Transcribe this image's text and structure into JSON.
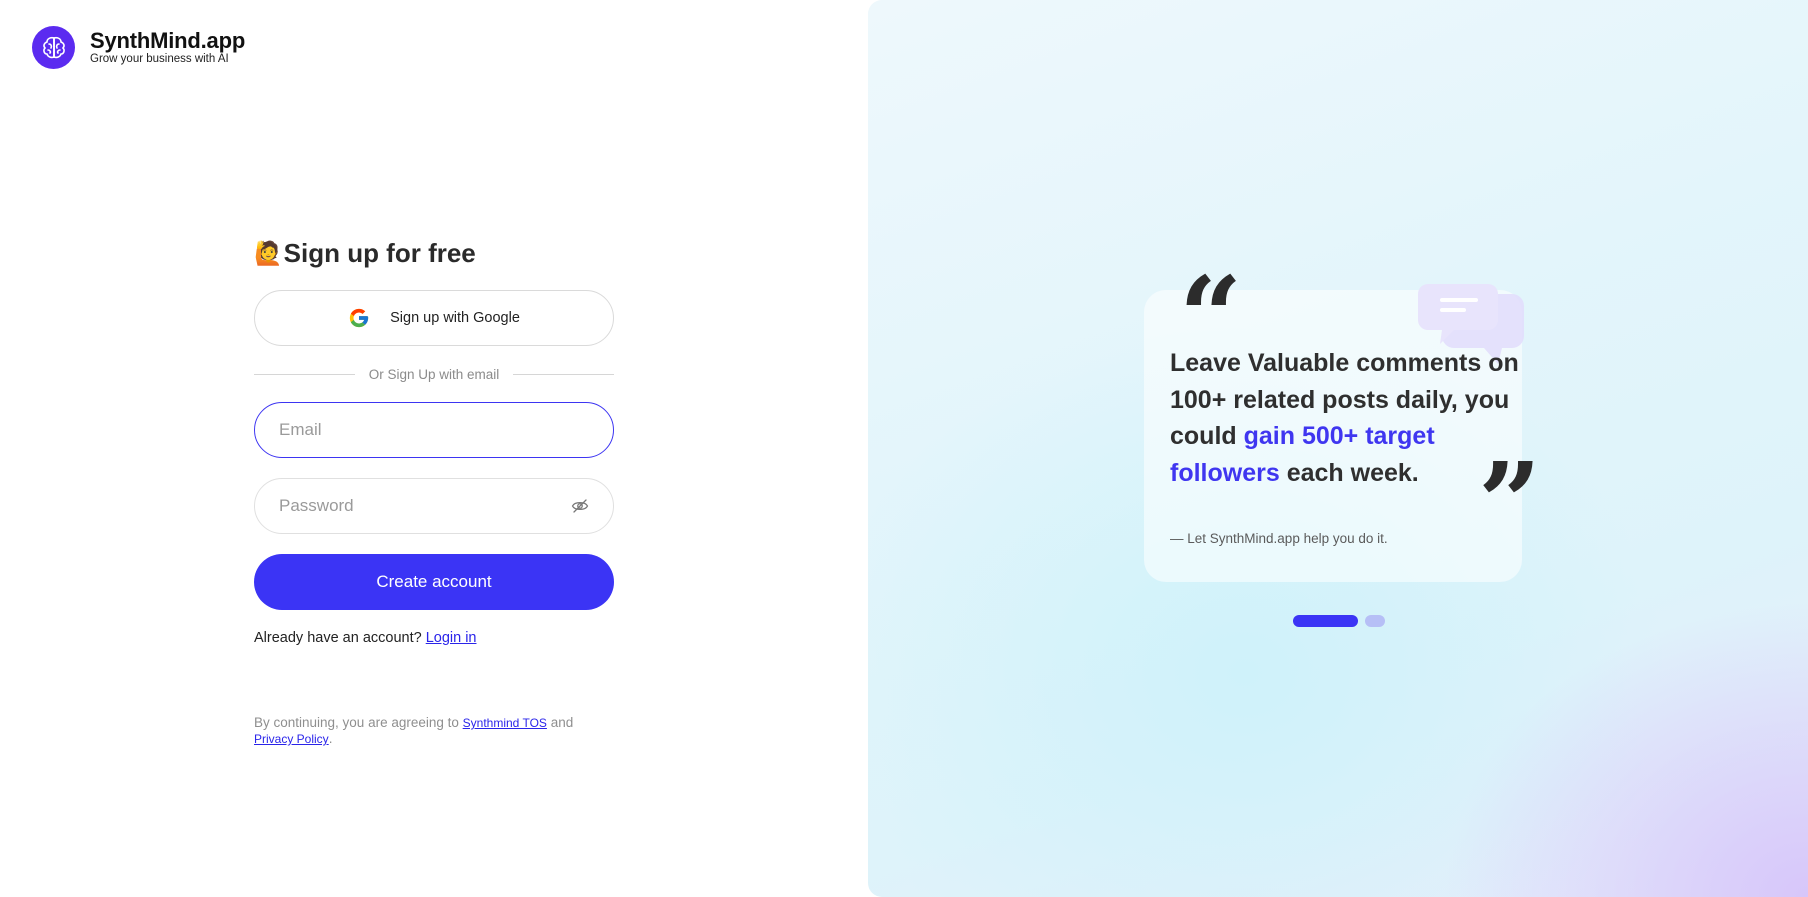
{
  "brand": {
    "name": "SynthMind.app",
    "tagline": "Grow your business with AI"
  },
  "signup": {
    "title_emoji": "🙋",
    "title": "Sign up for free",
    "google_label": "Sign up with Google",
    "divider_text": "Or Sign Up with email",
    "email_placeholder": "Email",
    "password_placeholder": "Password",
    "create_label": "Create account",
    "login_prompt": "Already have an account?",
    "login_link": "Login in",
    "terms_prefix": "By continuing, you are agreeing to",
    "tos_link": "Synthmind TOS",
    "terms_and": "and",
    "privacy_link": "Privacy Policy",
    "terms_suffix": "."
  },
  "testimonial": {
    "open_quote": "“",
    "close_quote": "”",
    "text_part1": "Leave Valuable comments on 100+ related posts daily, you could ",
    "highlight": "gain 500+ target followers",
    "text_part2": " each week.",
    "attribution": "— Let SynthMind.app help you do it.",
    "slides_total": 2,
    "slide_active": 1
  },
  "colors": {
    "accent": "#3b34f5",
    "brand": "#5b2bf0",
    "highlight": "#3f36f0"
  },
  "icons": {
    "logo": "brain-icon",
    "google": "google-icon",
    "eye": "eye-off-icon",
    "chat": "chat-bubble-icon"
  }
}
